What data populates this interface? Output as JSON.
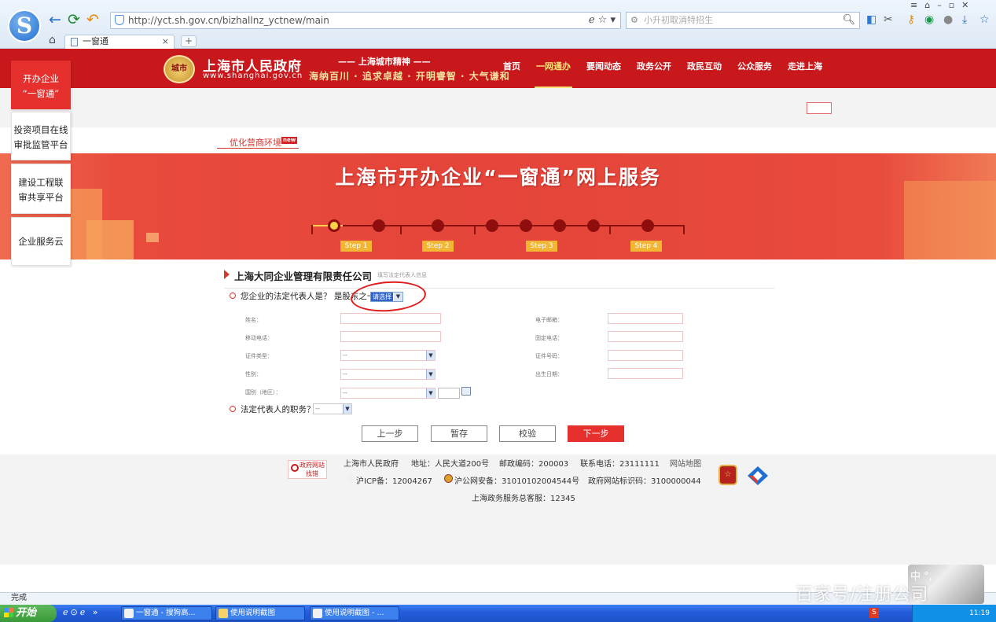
{
  "browser": {
    "url": "http://yct.sh.gov.cn/bizhallnz_yctnew/main",
    "search_placeholder": "小升初取消特招生",
    "tab_title": "一窗通",
    "new_tab": "+",
    "tab_close": "×",
    "status": "完成"
  },
  "site": {
    "gov_name": "上海市人民政府",
    "gov_url": "www.shanghai.gov.cn",
    "logo_text": "城市",
    "spirit_title": "—— 上海城市精神 ——",
    "spirit_slogan": "海纳百川 · 追求卓越 · 开明睿智 · 大气谦和",
    "nav": [
      {
        "label": "首页",
        "active": false
      },
      {
        "label": "一网通办",
        "active": true
      },
      {
        "label": "要闻动态",
        "active": false
      },
      {
        "label": "政务公开",
        "active": false
      },
      {
        "label": "政民互动",
        "active": false
      },
      {
        "label": "公众服务",
        "active": false
      },
      {
        "label": "走进上海",
        "active": false
      }
    ]
  },
  "sidebar": [
    {
      "line1": "开办企业",
      "line2": "“一窗通”",
      "active": true
    },
    {
      "line1": "投资项目在线",
      "line2": "审批监管平台",
      "active": false
    },
    {
      "line1": "建设工程联",
      "line2": "审共享平台",
      "active": false
    },
    {
      "line1": "企业服务云",
      "line2": "",
      "active": false
    }
  ],
  "optimize_link": "优化营商环境",
  "new_badge": "new",
  "banner": {
    "title": "上海市开办企业“一窗通”网上服务",
    "steps": [
      "Step 1",
      "Step 2",
      "Step 3",
      "Step 4"
    ]
  },
  "form": {
    "company": "上海大同企业管理有限责任公司",
    "subtitle": "填写法定代表人信息",
    "q1": "您企业的法定代表人是？ 是股东之一",
    "q1_select": "请选择",
    "labels": {
      "name": "姓名：",
      "email": "电子邮箱：",
      "mobile": "移动电话：",
      "phone": "固定电话：",
      "id_type": "证件类型：",
      "id_number": "证件号码：",
      "gender": "性别：",
      "birth": "出生日期：",
      "nationality": "国别（地区）："
    },
    "select_default": "--",
    "q2": "法定代表人的职务？",
    "q2_select": "--",
    "buttons": {
      "prev": "上一步",
      "save": "暂存",
      "check": "校验",
      "next": "下一步"
    }
  },
  "footer": {
    "gov_find": "政府网站\n找错",
    "line1": [
      "上海市人民政府",
      "地址：人民大道200号",
      "邮政编码：200003",
      "联系电话：23111111",
      "网站地图"
    ],
    "line2": [
      "沪ICP备：12004267",
      "沪公网安备：31010102004544号",
      "政府网站标识码：3100000044"
    ],
    "line3": "上海政务服务总客服：12345"
  },
  "taskbar": {
    "start": "开始",
    "tasks": [
      "一窗通 - 搜狗高...",
      "使用说明截图",
      "使用说明截图 - ..."
    ],
    "time": "11:19"
  },
  "overlay": {
    "ime": "中 °,",
    "watermark": "百家号/注册公司"
  }
}
